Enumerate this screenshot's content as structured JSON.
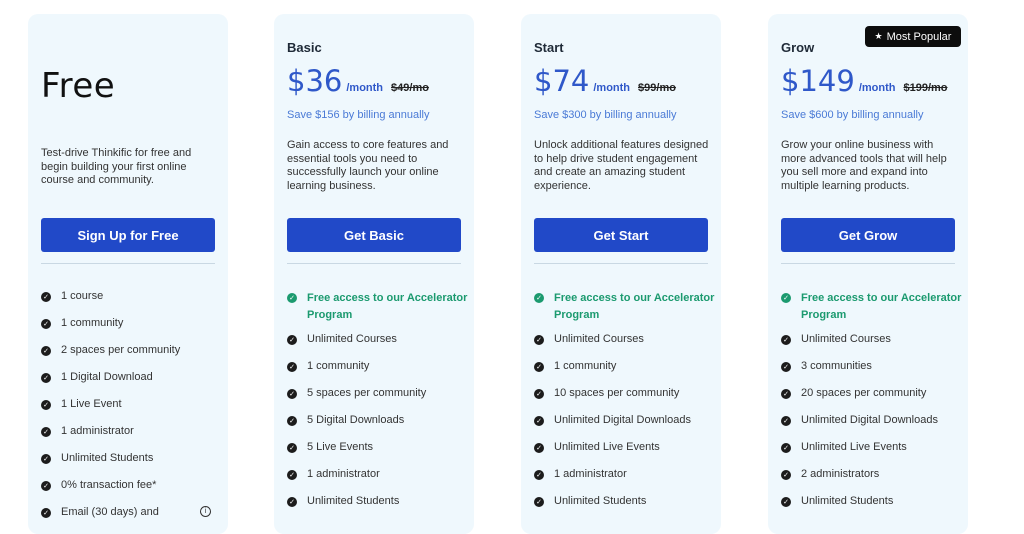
{
  "plans": [
    {
      "name": "Free",
      "description": "Test-drive Thinkific for free and begin building your first online course and community.",
      "button": "Sign Up for Free",
      "features": [
        "1 course",
        "1 community",
        "2 spaces per community",
        "1 Digital Download",
        "1 Live Event",
        "1 administrator",
        "Unlimited Students",
        "0% transaction fee*",
        "Email (30 days) and"
      ]
    },
    {
      "name": "Basic",
      "price": "$36",
      "per": "/month",
      "old_price": "$49/mo",
      "save": "Save $156 by billing annually",
      "description": "Gain access to core features and essential tools you need to successfully launch your online learning business.",
      "button": "Get Basic",
      "promo": "Free access to our Accelerator Program",
      "features": [
        "Unlimited Courses",
        "1 community",
        "5 spaces per community",
        "5 Digital Downloads",
        "5 Live Events",
        "1 administrator",
        "Unlimited Students"
      ]
    },
    {
      "name": "Start",
      "price": "$74",
      "per": "/month",
      "old_price": "$99/mo",
      "save": "Save $300 by billing annually",
      "description": "Unlock additional features designed to help drive student engagement and create an amazing student experience.",
      "button": "Get Start",
      "promo": "Free access to our Accelerator Program",
      "features": [
        "Unlimited Courses",
        "1 community",
        "10 spaces per community",
        "Unlimited Digital Downloads",
        "Unlimited Live Events",
        "1 administrator",
        "Unlimited Students"
      ]
    },
    {
      "name": "Grow",
      "price": "$149",
      "per": "/month",
      "old_price": "$199/mo",
      "save": "Save $600 by billing annually",
      "description": "Grow your online business with more advanced tools that will help you sell more and expand into multiple learning products.",
      "button": "Get Grow",
      "promo": "Free access to our Accelerator Program",
      "features": [
        "Unlimited Courses",
        "3 communities",
        "20 spaces per community",
        "Unlimited Digital Downloads",
        "Unlimited Live Events",
        "2 administrators",
        "Unlimited Students"
      ]
    }
  ],
  "badge": {
    "label": "Most Popular",
    "icon": "star-icon"
  },
  "colors": {
    "card_bg": "#eff8fd",
    "button": "#2149c8",
    "price": "#2f58c9",
    "promo": "#1b9a6f"
  }
}
